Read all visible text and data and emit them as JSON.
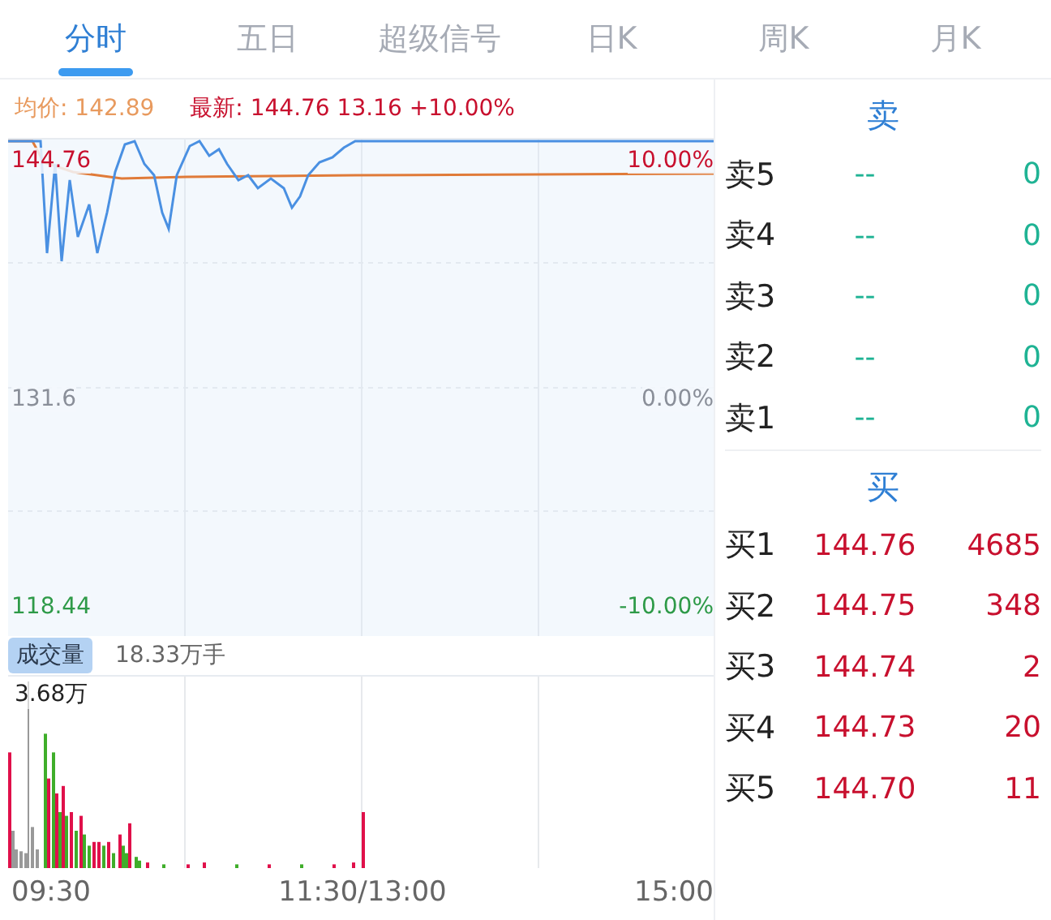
{
  "tabs": [
    {
      "label": "分时",
      "selected": true
    },
    {
      "label": "五日",
      "selected": false
    },
    {
      "label": "超级信号",
      "selected": false
    },
    {
      "label": "日K",
      "selected": false
    },
    {
      "label": "周K",
      "selected": false
    },
    {
      "label": "月K",
      "selected": false
    }
  ],
  "info": {
    "avg_label": "均价:",
    "avg": "142.89",
    "latest_label": "最新:",
    "latest": "144.76",
    "change": "13.16",
    "change_pct": "+10.00%"
  },
  "price_chart": {
    "levels": [
      {
        "price": "144.76",
        "pct": "10.00%",
        "color": "#c8102e"
      },
      {
        "price": "131.6",
        "pct": "0.00%",
        "color": "#8a8f99"
      },
      {
        "price": "118.44",
        "pct": "-10.00%",
        "color": "#2e9a48"
      }
    ]
  },
  "volume": {
    "label": "成交量",
    "total": "18.33万手",
    "max": "3.68万"
  },
  "time_axis": [
    "09:30",
    "11:30/13:00",
    "15:00"
  ],
  "order_book": [
    {
      "title": "卖",
      "rows": [
        {
          "label": "卖5",
          "price": "--",
          "volume": "0",
          "color": "#1fb394"
        },
        {
          "label": "卖4",
          "price": "--",
          "volume": "0",
          "color": "#1fb394"
        },
        {
          "label": "卖3",
          "price": "--",
          "volume": "0",
          "color": "#1fb394"
        },
        {
          "label": "卖2",
          "price": "--",
          "volume": "0",
          "color": "#1fb394"
        },
        {
          "label": "卖1",
          "price": "--",
          "volume": "0",
          "color": "#1fb394"
        }
      ]
    },
    {
      "title": "买",
      "rows": [
        {
          "label": "买1",
          "price": "144.76",
          "volume": "4685",
          "color": "#c8102e"
        },
        {
          "label": "买2",
          "price": "144.75",
          "volume": "348",
          "color": "#c8102e"
        },
        {
          "label": "买3",
          "price": "144.74",
          "volume": "2",
          "color": "#c8102e"
        },
        {
          "label": "买4",
          "price": "144.73",
          "volume": "20",
          "color": "#c8102e"
        },
        {
          "label": "买5",
          "price": "144.70",
          "volume": "11",
          "color": "#c8102e"
        }
      ]
    }
  ]
}
